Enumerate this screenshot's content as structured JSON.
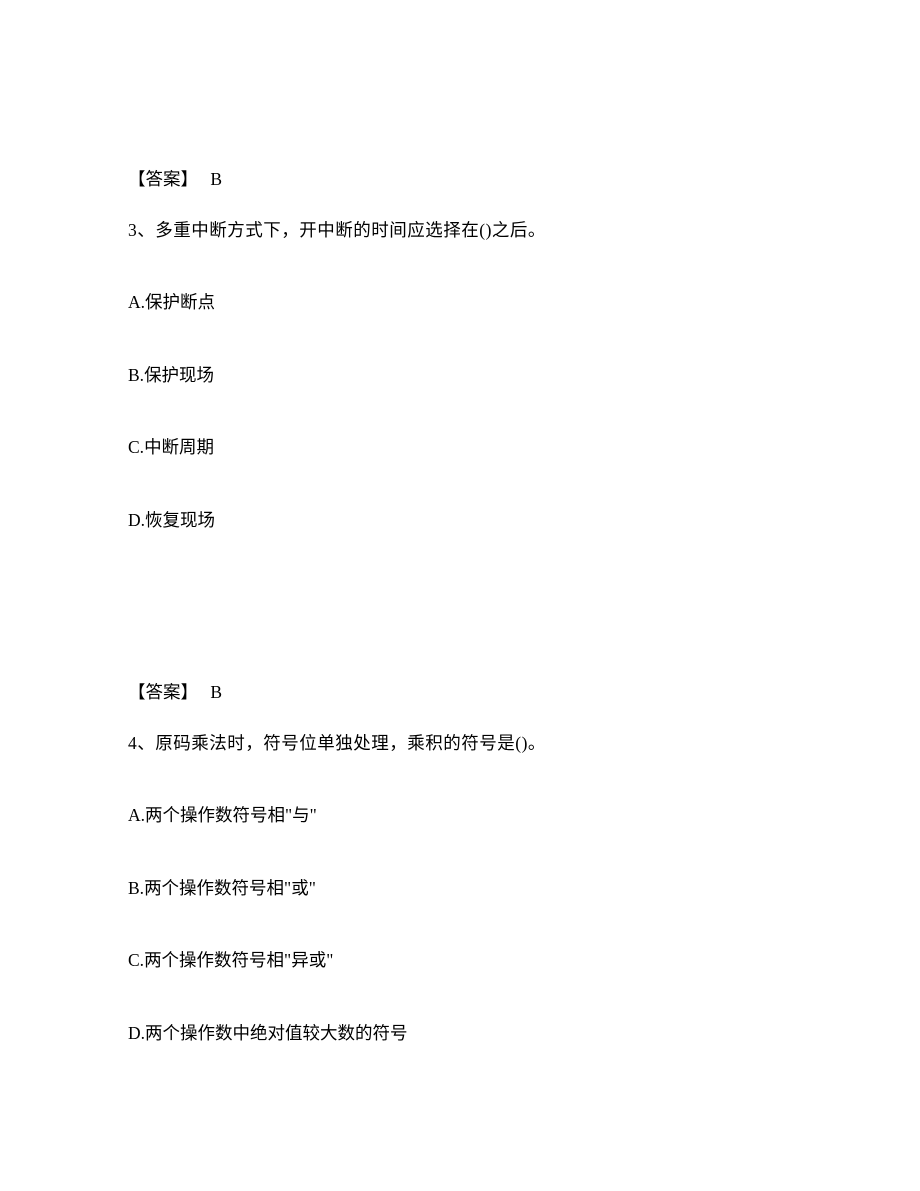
{
  "answer2": {
    "label": "【答案】",
    "value": "B"
  },
  "question3": {
    "text": "3、多重中断方式下，开中断的时间应选择在()之后。",
    "options": {
      "a": {
        "prefix": "A.",
        "text": "保护断点"
      },
      "b": {
        "prefix": "B.",
        "text": "保护现场"
      },
      "c": {
        "prefix": "C.",
        "text": "中断周期"
      },
      "d": {
        "prefix": "D.",
        "text": "恢复现场"
      }
    }
  },
  "answer3": {
    "label": "【答案】",
    "value": "B"
  },
  "question4": {
    "text": "4、原码乘法时，符号位单独处理，乘积的符号是()。",
    "options": {
      "a": {
        "prefix": "A.",
        "text": "两个操作数符号相\"与\""
      },
      "b": {
        "prefix": "B.",
        "text": "两个操作数符号相\"或\""
      },
      "c": {
        "prefix": "C.",
        "text": "两个操作数符号相\"异或\""
      },
      "d": {
        "prefix": "D.",
        "text": "两个操作数中绝对值较大数的符号"
      }
    }
  }
}
